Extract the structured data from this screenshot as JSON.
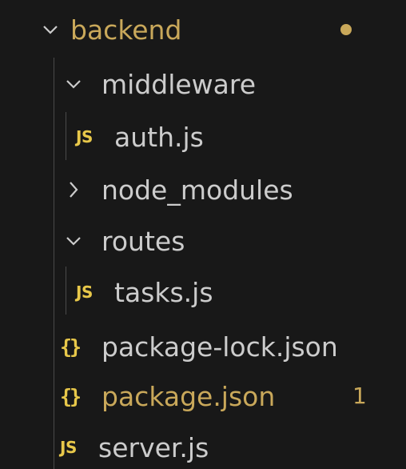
{
  "explorer": {
    "colors": {
      "background": "#181818",
      "text": "#cccccc",
      "modified": "#c9a85a",
      "icon_accent": "#e8c84a"
    },
    "items": [
      {
        "label": "backend",
        "kind": "folder",
        "expanded": true,
        "modified": true,
        "icon": "chevron-down-icon"
      },
      {
        "label": "middleware",
        "kind": "folder",
        "expanded": true,
        "icon": "chevron-down-icon"
      },
      {
        "label": "auth.js",
        "kind": "file",
        "icon": "javascript-file-icon",
        "icon_text": "JS"
      },
      {
        "label": "node_modules",
        "kind": "folder",
        "expanded": false,
        "icon": "chevron-right-icon"
      },
      {
        "label": "routes",
        "kind": "folder",
        "expanded": true,
        "icon": "chevron-down-icon"
      },
      {
        "label": "tasks.js",
        "kind": "file",
        "icon": "javascript-file-icon",
        "icon_text": "JS"
      },
      {
        "label": "package-lock.json",
        "kind": "file",
        "icon": "json-file-icon",
        "icon_text": "{}"
      },
      {
        "label": "package.json",
        "kind": "file",
        "icon": "json-file-icon",
        "icon_text": "{}",
        "modified": true,
        "problem_count": "1"
      },
      {
        "label": "server.js",
        "kind": "file",
        "icon": "javascript-file-icon",
        "icon_text": "JS"
      }
    ]
  }
}
